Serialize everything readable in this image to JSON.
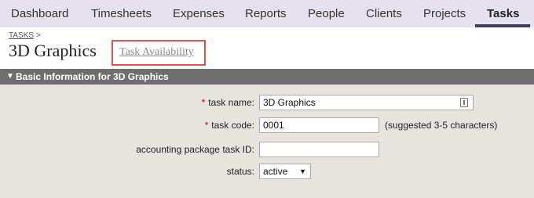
{
  "nav": {
    "items": [
      "Dashboard",
      "Timesheets",
      "Expenses",
      "Reports",
      "People",
      "Clients",
      "Projects",
      "Tasks"
    ],
    "active": "Tasks"
  },
  "header": {
    "breadcrumb_link": "TASKS",
    "breadcrumb_sep": ">",
    "title": "3D Graphics",
    "availability_link": "Task Availability"
  },
  "section": {
    "toggle_icon": "triangle-down",
    "title": "Basic Information for 3D Graphics"
  },
  "form": {
    "required_mark": "*",
    "task_name_label": "task name:",
    "task_name_value": "3D Graphics",
    "task_code_label": "task code:",
    "task_code_value": "0001",
    "task_code_hint": "(suggested 3-5 characters)",
    "accounting_label": "accounting package task ID:",
    "accounting_value": "",
    "status_label": "status:",
    "status_value": "active"
  },
  "colors": {
    "nav_bg": "#e6e1ef",
    "nav_active_underline": "#3d3d66",
    "section_bar": "#6e6e6e",
    "form_bg": "#e7e4e0",
    "highlight": "#d9534f",
    "required": "#dd0000"
  }
}
